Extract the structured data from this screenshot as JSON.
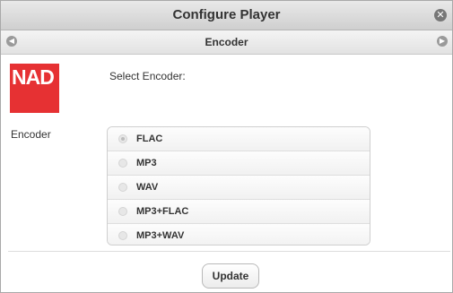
{
  "window": {
    "title": "Configure Player"
  },
  "subheader": {
    "title": "Encoder"
  },
  "logo": {
    "text": "NAD",
    "color": "#e63133"
  },
  "form": {
    "select_label": "Select Encoder:",
    "encoder_label": "Encoder",
    "options": [
      {
        "label": "FLAC",
        "selected": true
      },
      {
        "label": "MP3",
        "selected": false
      },
      {
        "label": "WAV",
        "selected": false
      },
      {
        "label": "MP3+FLAC",
        "selected": false
      },
      {
        "label": "MP3+WAV",
        "selected": false
      }
    ]
  },
  "actions": {
    "update_label": "Update"
  },
  "icons": {
    "close": "close-icon",
    "back": "back-icon",
    "forward": "forward-icon"
  }
}
